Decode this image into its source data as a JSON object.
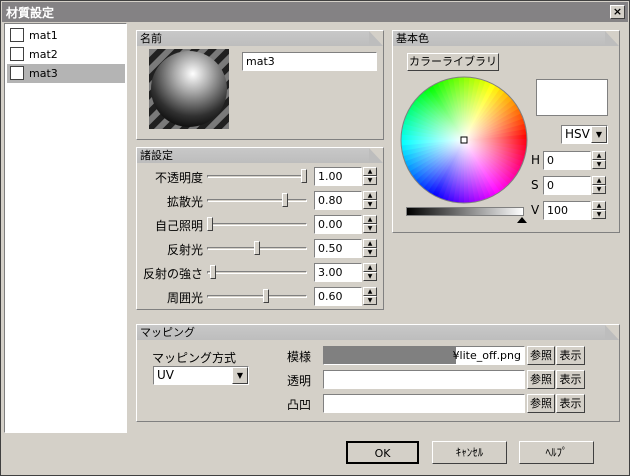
{
  "window": {
    "title": "材質設定",
    "close_label": "×"
  },
  "materials": [
    {
      "label": "mat1",
      "selected": false
    },
    {
      "label": "mat2",
      "selected": false
    },
    {
      "label": "mat3",
      "selected": true
    }
  ],
  "name_group": {
    "title": "名前",
    "name_value": "mat3"
  },
  "settings_group": {
    "title": "諸設定",
    "rows": [
      {
        "label": "不透明度",
        "value": "1.00",
        "level": 1.0
      },
      {
        "label": "拡散光",
        "value": "0.80",
        "level": 0.8
      },
      {
        "label": "自己照明",
        "value": "0.00",
        "level": 0.0
      },
      {
        "label": "反射光",
        "value": "0.50",
        "level": 0.5
      },
      {
        "label": "反射の強さ",
        "value": "3.00",
        "level": 0.03
      },
      {
        "label": "周囲光",
        "value": "0.60",
        "level": 0.6
      }
    ]
  },
  "color_group": {
    "title": "基本色",
    "library_button": "カラーライブラリ",
    "mode": "HSV",
    "h_label": "H",
    "h_value": "0",
    "s_label": "S",
    "s_value": "0",
    "v_label": "V",
    "v_value": "100"
  },
  "mapping_group": {
    "title": "マッピング",
    "method_label": "マッピング方式",
    "method_value": "UV",
    "pattern_label": "模様",
    "pattern_value": "¥lite_off.png",
    "alpha_label": "透明",
    "alpha_value": "",
    "bump_label": "凸凹",
    "bump_value": "",
    "browse_label": "参照",
    "show_label": "表示"
  },
  "footer": {
    "ok": "OK",
    "cancel": "ｷｬﾝｾﾙ",
    "help": "ﾍﾙﾌﾟ"
  },
  "colors": {
    "titlebar": "#848284",
    "face": "#d4d0c8",
    "selected_item": "#b4b4b4"
  }
}
